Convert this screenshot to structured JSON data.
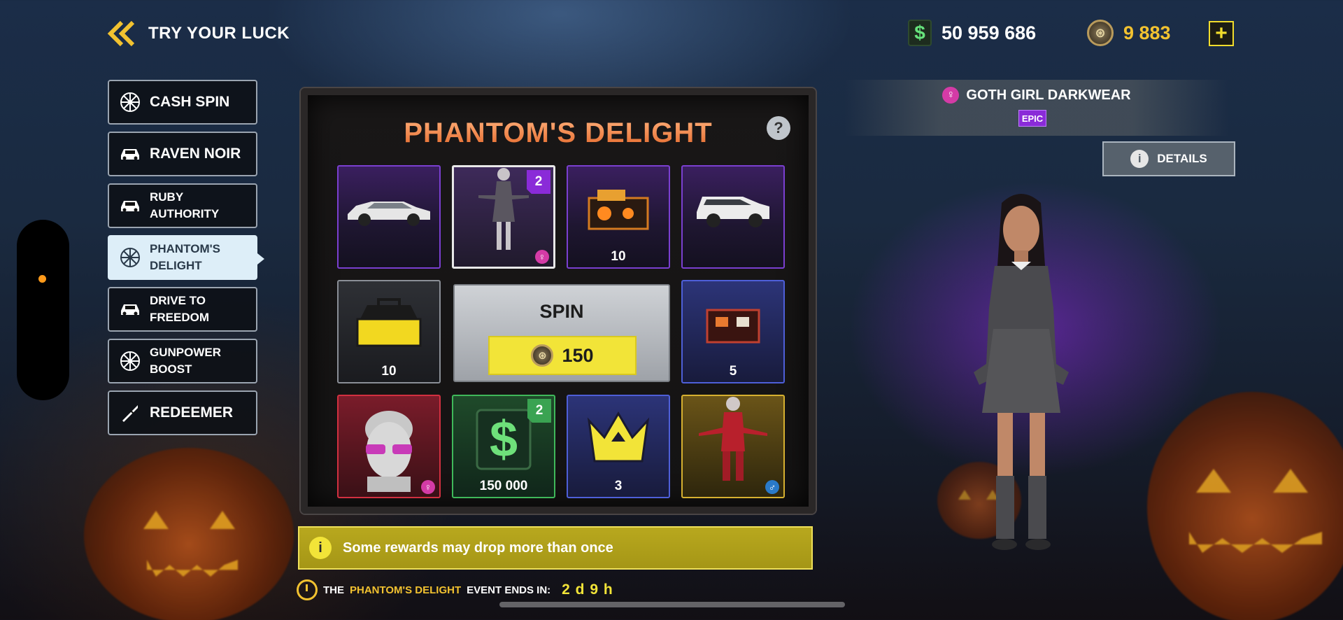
{
  "header": {
    "title": "TRY YOUR LUCK"
  },
  "wallet": {
    "cash": "50 959 686",
    "coins": "9 883"
  },
  "menu": {
    "items": [
      {
        "label": "CASH SPIN",
        "icon": "wheel-icon",
        "size": "large"
      },
      {
        "label": "RAVEN NOIR",
        "icon": "car-icon",
        "size": "large"
      },
      {
        "label": "RUBY\nAUTHORITY",
        "icon": "car-icon",
        "size": "small"
      },
      {
        "label": "PHANTOM'S\nDELIGHT",
        "icon": "wheel-icon",
        "size": "small",
        "active": true
      },
      {
        "label": "DRIVE TO\nFREEDOM",
        "icon": "car-icon",
        "size": "small"
      },
      {
        "label": "GUNPOWER\nBOOST",
        "icon": "wheel-icon",
        "size": "small"
      },
      {
        "label": "REDEEMER",
        "icon": "bullet-icon",
        "size": "large"
      }
    ]
  },
  "panel": {
    "title": "PHANTOM'S DELIGHT",
    "help": "?",
    "spin": {
      "label": "SPIN",
      "cost": "150"
    },
    "rewards": [
      {
        "name": "white-sedan",
        "quantity": "",
        "rarity": "epic"
      },
      {
        "name": "goth-girl-outfit",
        "badge": "2",
        "gender": "♀",
        "rarity": "selected"
      },
      {
        "name": "halloween-crate",
        "quantity": "10",
        "rarity": "epic"
      },
      {
        "name": "white-suv",
        "quantity": "",
        "rarity": "epic"
      },
      {
        "name": "toolbox",
        "quantity": "10",
        "rarity": "common"
      },
      {
        "name": "ammo-case",
        "quantity": "5",
        "rarity": "rare"
      },
      {
        "name": "sunglasses-head",
        "gender": "♀",
        "rarity": "legendary-red"
      },
      {
        "name": "cash-reward",
        "quantity": "150 000",
        "badge": "2",
        "rarity": "uncommon"
      },
      {
        "name": "crown",
        "quantity": "3",
        "rarity": "rare"
      },
      {
        "name": "red-suit-outfit",
        "gender": "♂",
        "rarity": "gold"
      }
    ]
  },
  "info": {
    "text": "Some rewards may drop more than once",
    "icon": "i"
  },
  "event": {
    "prefix": "THE",
    "name": "PHANTOM'S DELIGHT",
    "suffix": "EVENT ENDS IN:",
    "time": "2 d 9 h"
  },
  "preview": {
    "gender": "♀",
    "name": "GOTH GIRL DARKWEAR",
    "rarity": "EPIC",
    "details_label": "DETAILS"
  },
  "colors": {
    "accent": "#f2e438",
    "epic": "#8a2bd8",
    "title": "#ef8a4a"
  }
}
